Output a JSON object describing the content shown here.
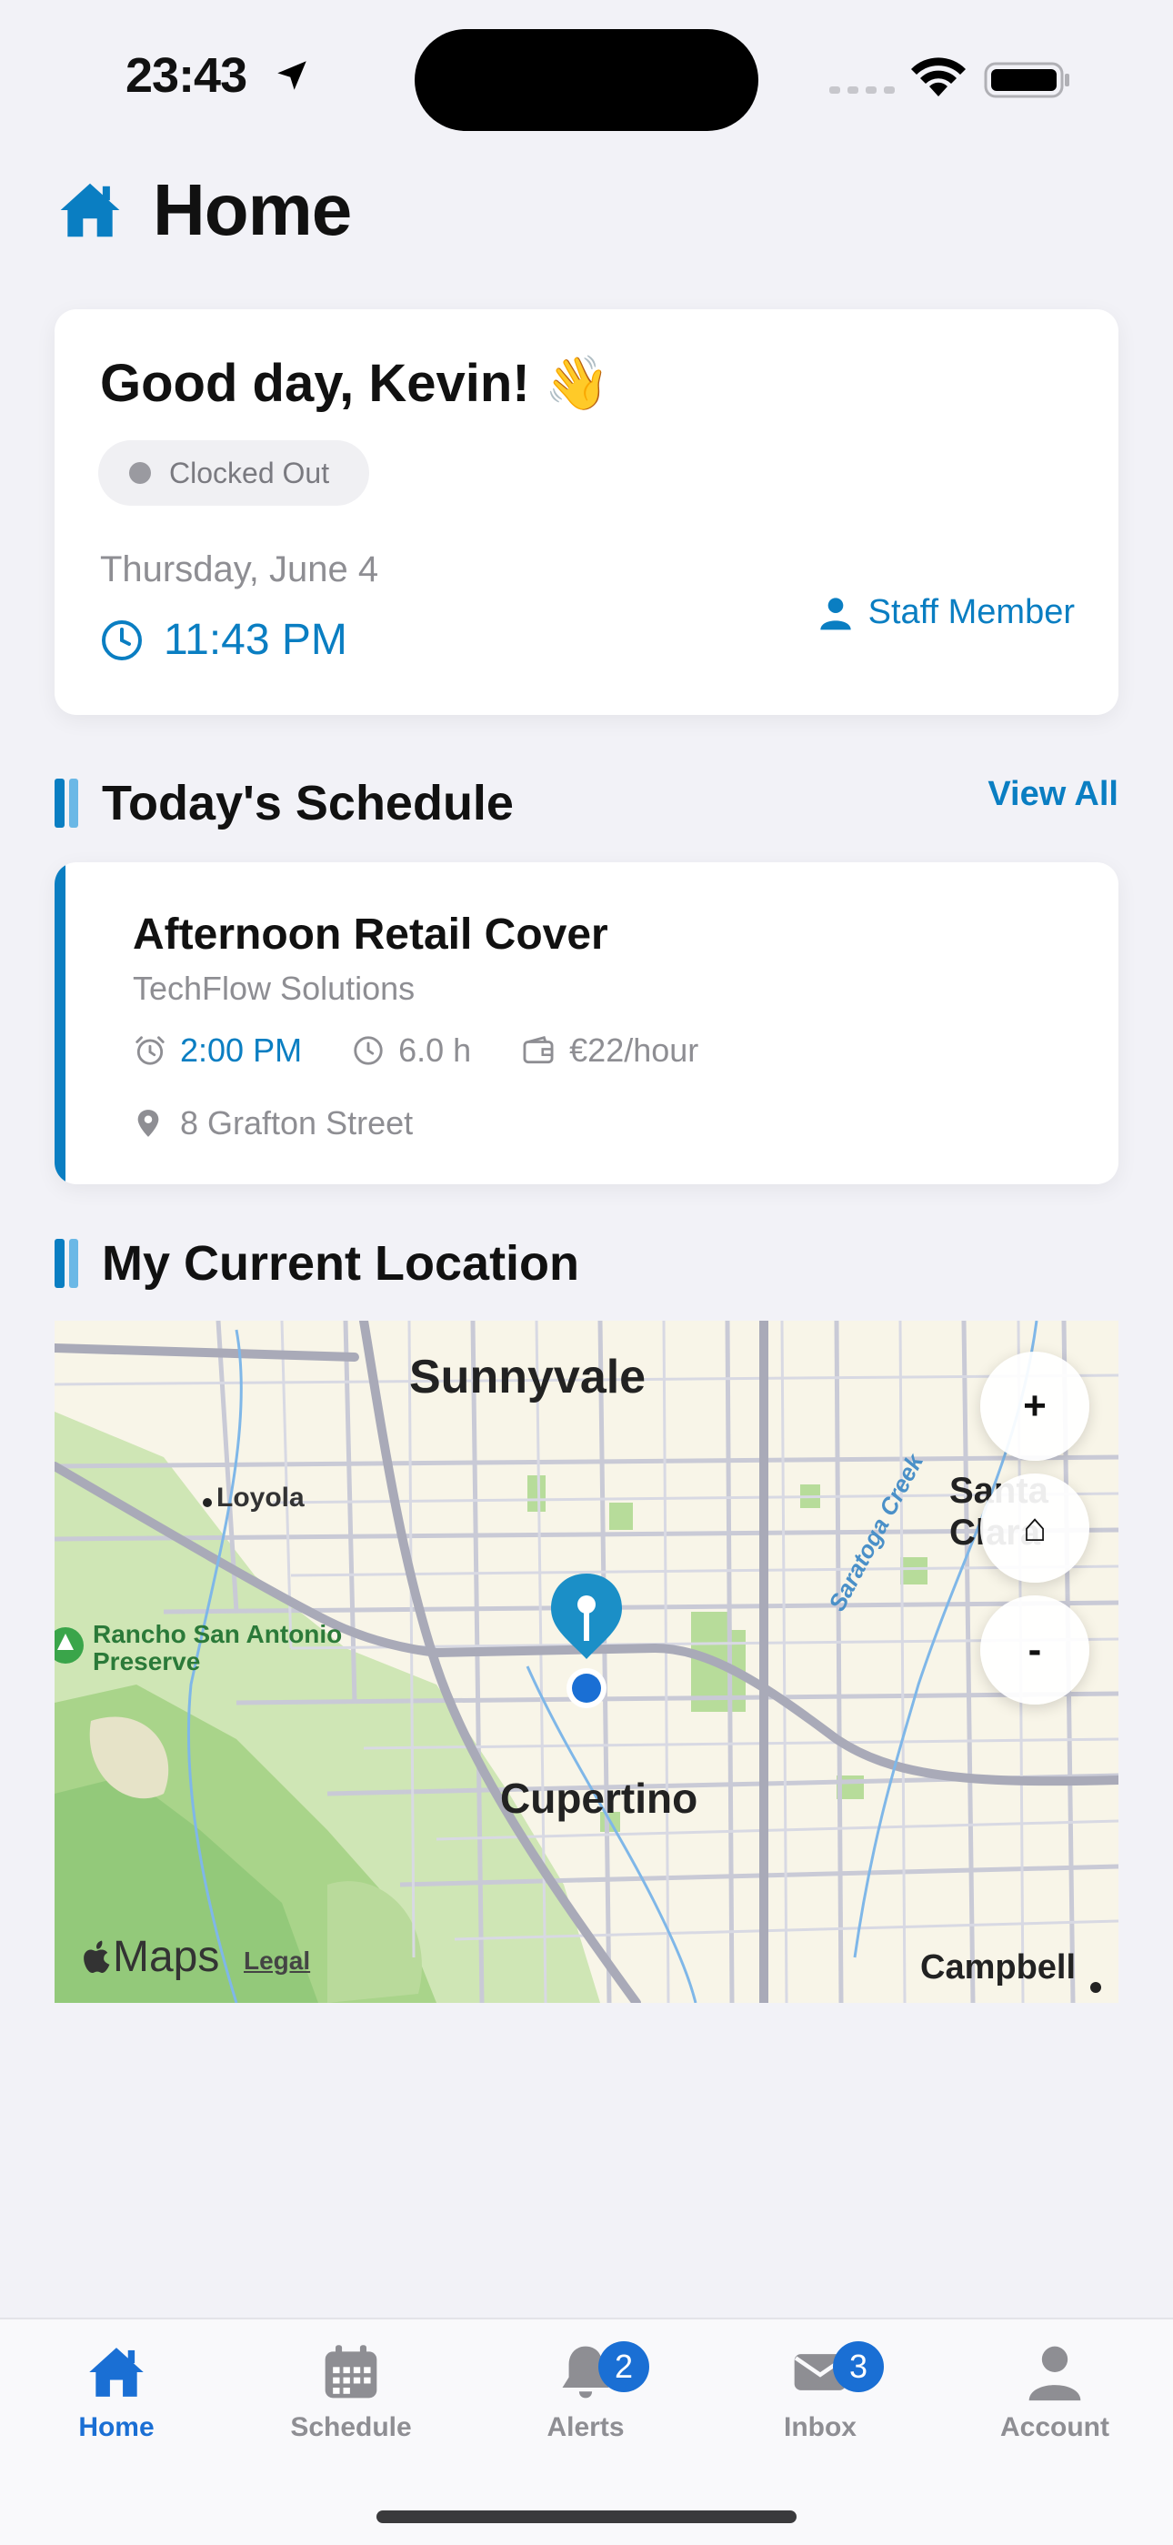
{
  "status_bar": {
    "time": "23:43"
  },
  "header": {
    "title": "Home",
    "icon": "house-icon"
  },
  "greeting_card": {
    "greeting": "Good day, Kevin! 👋",
    "clock_status": "Clocked Out",
    "date": "Thursday, June 4",
    "current_time": "11:43 PM",
    "role": "Staff Member"
  },
  "schedule": {
    "section_title": "Today's Schedule",
    "view_all_label": "View All",
    "shift": {
      "title": "Afternoon Retail Cover",
      "company": "TechFlow Solutions",
      "start_time": "2:00 PM",
      "duration": "6.0 h",
      "rate": "€22/hour",
      "address": "8 Grafton Street"
    }
  },
  "location": {
    "section_title": "My Current Location",
    "map_labels": {
      "sunnyvale": "Sunnyvale",
      "loyola": "Loyola",
      "santa_clara": "Santa Clara",
      "rancho": "Rancho San Antonio Preserve",
      "cupertino": "Cupertino",
      "campbell": "Campbell",
      "saratoga_creek": "Saratoga Creek"
    },
    "controls": {
      "zoom_in": "+",
      "home": "⌂",
      "zoom_out": "-"
    },
    "attribution": {
      "maps": "Maps",
      "legal": "Legal"
    }
  },
  "tab_bar": {
    "tabs": [
      {
        "label": "Home",
        "icon": "house-icon",
        "active": true
      },
      {
        "label": "Schedule",
        "icon": "calendar-icon"
      },
      {
        "label": "Alerts",
        "icon": "bell-icon",
        "badge": "2"
      },
      {
        "label": "Inbox",
        "icon": "envelope-icon",
        "badge": "3"
      },
      {
        "label": "Account",
        "icon": "person-icon"
      }
    ]
  },
  "colors": {
    "accent": "#0a7ec2",
    "tab_active": "#1a6fd4",
    "background": "#f2f2f7"
  }
}
